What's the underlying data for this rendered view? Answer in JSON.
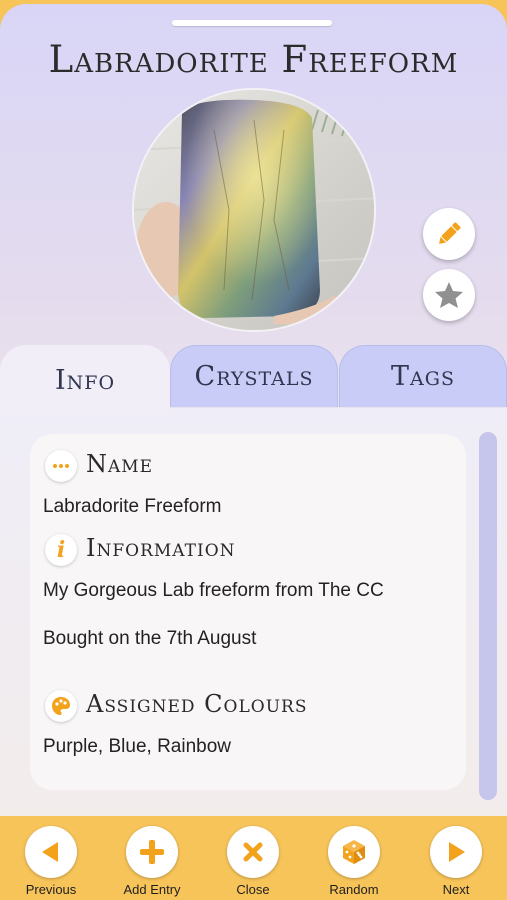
{
  "header": {
    "title": "Labradorite Freeform"
  },
  "photo": {
    "alt": "Labradorite freeform crystal held in hand"
  },
  "actions": {
    "edit_icon": "pencil-icon",
    "favourite_icon": "star-icon"
  },
  "tabs": [
    {
      "label": "Info",
      "active": true
    },
    {
      "label": "Crystals",
      "active": false
    },
    {
      "label": "Tags",
      "active": false
    }
  ],
  "info": {
    "name": {
      "heading": "Name",
      "icon": "ellipsis-icon",
      "value": "Labradorite Freeform"
    },
    "information": {
      "heading": "Information",
      "icon": "info-icon",
      "lines": [
        "My Gorgeous Lab freeform from The CC",
        "Bought on the 7th August"
      ]
    },
    "colours": {
      "heading": "Assigned Colours",
      "icon": "palette-icon",
      "value": "Purple, Blue, Rainbow"
    }
  },
  "bottom_nav": [
    {
      "label": "Previous",
      "icon": "arrow-left-icon"
    },
    {
      "label": "Add Entry",
      "icon": "plus-icon"
    },
    {
      "label": "Close",
      "icon": "close-icon"
    },
    {
      "label": "Random",
      "icon": "dice-icon"
    },
    {
      "label": "Next",
      "icon": "arrow-right-icon"
    }
  ],
  "colors": {
    "accent": "#f3a21c",
    "bar": "#f7c45a",
    "tab_inactive": "#c8ccf6",
    "scrollbar": "#c6c6ec"
  }
}
